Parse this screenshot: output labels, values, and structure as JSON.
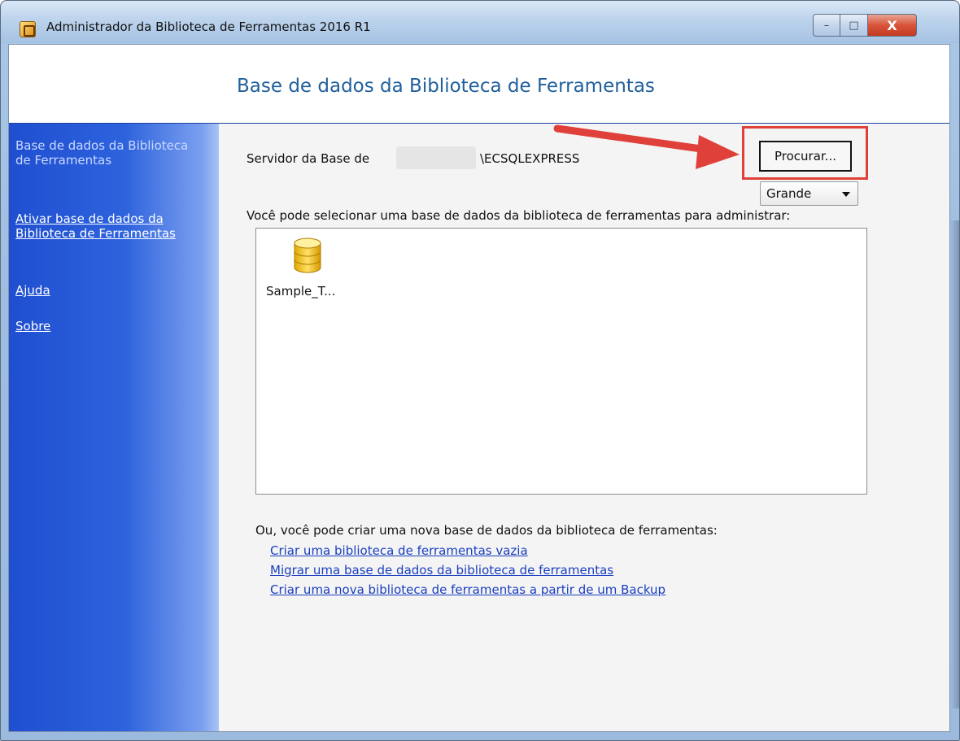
{
  "window": {
    "title": "Administrador da Biblioteca de Ferramentas 2016 R1",
    "minimize_symbol": "–",
    "maximize_symbol": "□",
    "close_symbol": "X"
  },
  "header": {
    "title": "Base de dados da Biblioteca de Ferramentas"
  },
  "sidebar": {
    "items": [
      {
        "label": "Base de dados da Biblioteca de Ferramentas"
      },
      {
        "label": "Ativar base de dados da Biblioteca de Ferramentas"
      },
      {
        "label": "Ajuda"
      },
      {
        "label": "Sobre"
      }
    ]
  },
  "main": {
    "server_label": "Servidor da Base de",
    "server_instance": "\\ECSQLEXPRESS",
    "browse_label": "Procurar...",
    "view_size": "Grande",
    "select_prompt": "Você pode selecionar uma base de dados da biblioteca de ferramentas para administrar:",
    "databases": [
      {
        "name": "Sample_T..."
      }
    ],
    "create_prompt": "Ou, você pode criar uma nova base de dados da biblioteca de ferramentas:",
    "actions": [
      {
        "label": "Criar uma biblioteca de ferramentas vazia"
      },
      {
        "label": "Migrar uma base de dados da biblioteca de ferramentas"
      },
      {
        "label": "Criar uma nova biblioteca de ferramentas a partir de um Backup"
      }
    ]
  },
  "colors": {
    "accent_title": "#1f5f9c",
    "sidebar_blue": "#2d62dd",
    "annotation_red": "#e0403a",
    "link_blue": "#1a3fc0"
  },
  "icons": {
    "app": "app-icon",
    "database": "database-icon",
    "dropdown": "chevron-down-icon",
    "annotation": "red-arrow-annotation"
  }
}
